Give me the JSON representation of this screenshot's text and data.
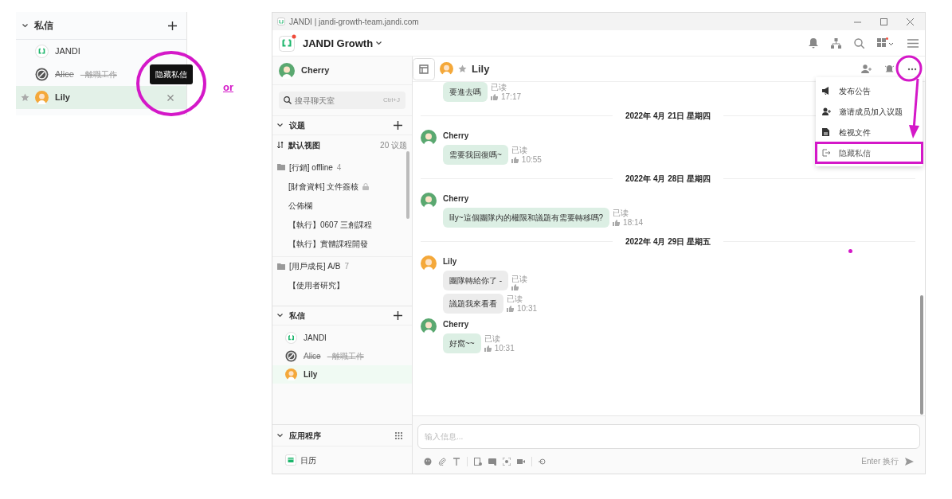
{
  "snippet": {
    "header": "私信",
    "items": [
      {
        "kind": "bot",
        "name": "JANDI",
        "selected": false
      },
      {
        "kind": "disabled",
        "name": "Alice",
        "note": "- 離職工作",
        "selected": false
      },
      {
        "kind": "user",
        "name": "Lily",
        "selected": true
      }
    ],
    "tooltip": "隐藏私信"
  },
  "or_label": "or",
  "window": {
    "title": "JANDI | jandi-growth-team.jandi.com"
  },
  "team": {
    "name": "JANDI Growth"
  },
  "sidebar": {
    "profile": "Cherry",
    "search": {
      "placeholder": "搜寻聊天室",
      "shortcut": "Ctrl+J"
    },
    "topics": {
      "header": "议题",
      "view": "默认视图",
      "count": "20 议题",
      "folders": [
        {
          "name": "[行銷] offline",
          "count": "4",
          "children": [
            {
              "name": "[財會資料] 文件簽核",
              "locked": true
            },
            {
              "name": "公佈欄",
              "locked": false
            },
            {
              "name": "【執行】0607 三創課程",
              "locked": false
            },
            {
              "name": "【執行】實體課程開發",
              "locked": false
            }
          ]
        },
        {
          "name": "[用戶成長] A/B",
          "count": "7",
          "children": [
            {
              "name": "【使用者研究】",
              "locked": false
            }
          ]
        }
      ]
    },
    "dms": {
      "header": "私信",
      "items": [
        {
          "kind": "bot",
          "name": "JANDI",
          "selected": false
        },
        {
          "kind": "disabled",
          "name": "Alice",
          "note": "- 離職工作",
          "selected": false
        },
        {
          "kind": "user",
          "name": "Lily",
          "selected": true
        }
      ]
    },
    "apps": {
      "header": "应用程序",
      "items": [
        {
          "name": "日历"
        }
      ]
    }
  },
  "chat": {
    "title": "Lily",
    "messages": [
      {
        "kind": "message",
        "own": true,
        "bubbles": [
          {
            "text": "要進去嗎",
            "read": "已读",
            "time": "17:17"
          }
        ]
      },
      {
        "kind": "date",
        "text": "2022年 4月 21日 星期四"
      },
      {
        "kind": "message",
        "author": "Cherry",
        "own": true,
        "bubbles": [
          {
            "text": "需要我回復嗎~",
            "read": "已读",
            "time": "10:55"
          }
        ]
      },
      {
        "kind": "date",
        "text": "2022年 4月 28日 星期四"
      },
      {
        "kind": "message",
        "author": "Cherry",
        "own": true,
        "bubbles": [
          {
            "text": "lily~這個團隊內的權限和議題有需要轉移嗎?",
            "read": "已读",
            "time": "18:14"
          }
        ]
      },
      {
        "kind": "date",
        "text": "2022年 4月 29日 星期五"
      },
      {
        "kind": "message",
        "author": "Lily",
        "own": false,
        "bubbles": [
          {
            "text": "團隊轉給你了 -",
            "read": "已读"
          },
          {
            "text": "議題我來看看",
            "read": "已读",
            "time": "10:31"
          }
        ]
      },
      {
        "kind": "message",
        "author": "Cherry",
        "own": true,
        "bubbles": [
          {
            "text": "好窩~~",
            "read": "已读",
            "time": "10:31"
          }
        ]
      }
    ],
    "menu": [
      {
        "kind": "announce",
        "label": "发布公告",
        "highlighted": false
      },
      {
        "kind": "invite",
        "label": "邀请成员加入议题",
        "highlighted": false
      },
      {
        "kind": "file",
        "label": "检视文件",
        "highlighted": false
      },
      {
        "kind": "hide",
        "label": "隐藏私信",
        "highlighted": true
      }
    ],
    "composer": {
      "placeholder": "输入信息...",
      "hint": "Enter 换行"
    }
  }
}
